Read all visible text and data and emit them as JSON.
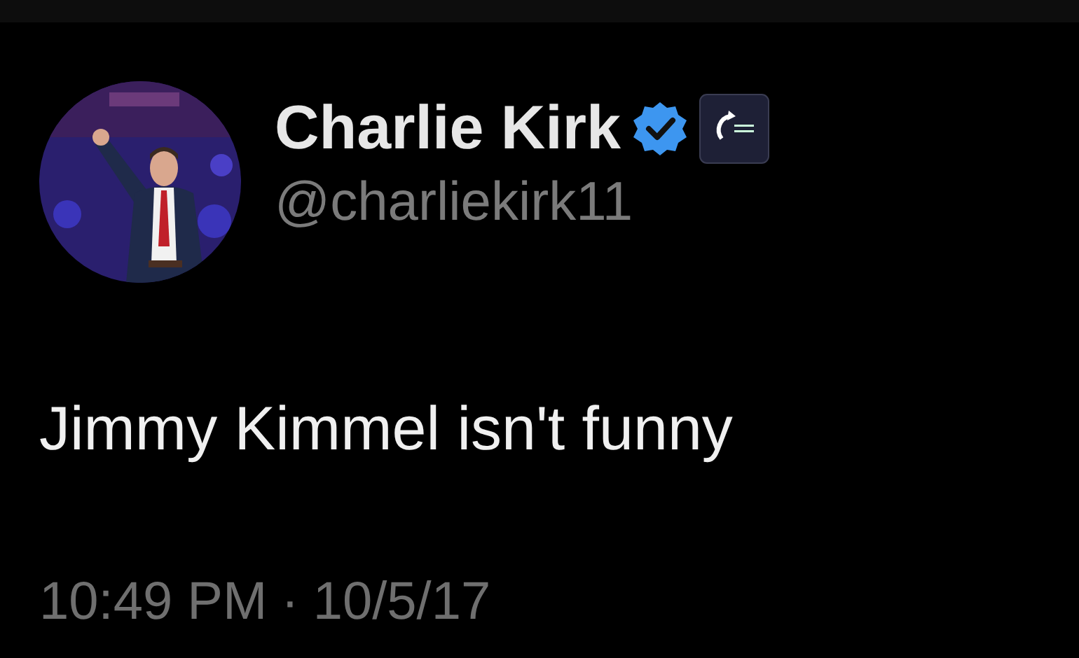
{
  "author": {
    "name": "Charlie Kirk",
    "handle": "@charliekirk11",
    "verified": true
  },
  "text": "Jimmy Kimmel isn't funny",
  "timestamp": {
    "time": "10:49 PM",
    "separator": "·",
    "date": "10/5/17"
  }
}
